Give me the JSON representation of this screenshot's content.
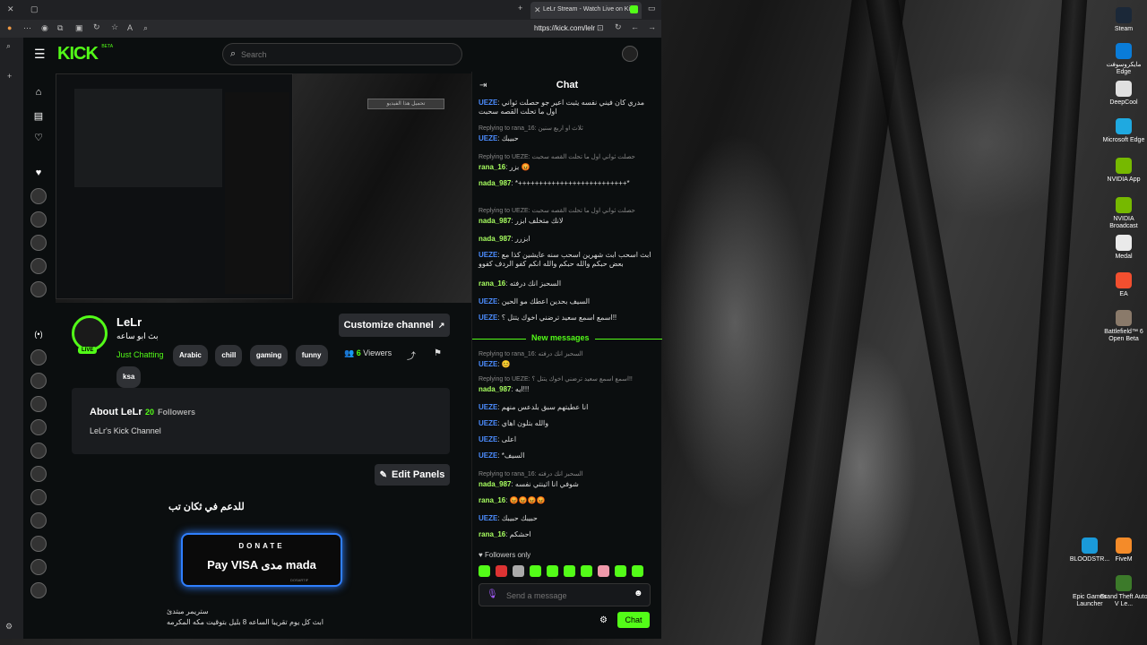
{
  "browser": {
    "tab_title": "LeLr Stream - Watch Live on Kick",
    "url": "https://kick.com/lelr"
  },
  "kick": {
    "logo_text": "KICK",
    "logo_beta": "BETA",
    "search_placeholder": "Search",
    "player_overlay_text": "تحميل هذا الفيديو",
    "channel": {
      "name": "LeLr",
      "stream_title": "بث ابو ساعه",
      "live_badge": "LIVE",
      "category": "Just Chatting",
      "tags": [
        "Arabic",
        "chill",
        "gaming",
        "funny",
        "ksa"
      ],
      "viewers_count": "6",
      "viewers_label": "Viewers",
      "customize_label": "Customize channel",
      "about_label": "About LeLr",
      "followers_count": "20",
      "followers_label": "Followers",
      "about_text": "LeLr's Kick Channel",
      "edit_panels_label": "Edit Panels",
      "panel_title": "للدعم في ثكان تب",
      "donate_label": "DONATE",
      "donate_payment": "Pay VISA مدى mada",
      "donate_footer": "DOSARTIF",
      "streamer_label": "ستريمر مبتدئ",
      "schedule_text": "ابث كل يوم تقريبا الساعه 8 بليل بتوقيت مكه المكرمه"
    },
    "chat": {
      "title": "Chat",
      "new_messages_label": "New messages",
      "followers_only_label": "Followers only",
      "input_placeholder": "Send a message",
      "send_label": "Chat",
      "messages": [
        {
          "user": "UEZE",
          "text": "مدري كان فيني نفسه يثبت اعير جو حصلت ثواني اول ما تحلت القصه سحبت",
          "reply": ""
        },
        {
          "user": "UEZE",
          "text": "حبيبك",
          "reply": "Replying to rana_16: ثلاث او اربع سنين"
        },
        {
          "user": "rana_16",
          "text": "بزر 😡",
          "reply": "Replying to UEZE: حصلت ثواني اول ما تحلت القصه سحبت"
        },
        {
          "user": "nada_987",
          "text": "*++++++++++++++++++++++++++*",
          "reply": ""
        },
        {
          "user": "nada_987",
          "text": "لانك متخلف ابزر",
          "reply": "Replying to UEZE: حصلت ثواني اول ما تحلت القصه سحبت"
        },
        {
          "user": "nada_987",
          "text": "ابزرر",
          "reply": ""
        },
        {
          "user": "UEZE",
          "text": "ابث اسحب ابث شهرين اسحب سنه عايشين كذا مع بعض حبكم والله حبكم والله انكم كفو الردف كفوو",
          "reply": ""
        },
        {
          "user": "rana_16",
          "text": "السحبز انك درفته",
          "reply": ""
        },
        {
          "user": "UEZE",
          "text": "السيف بحدين اعطك مو الحين",
          "reply": ""
        },
        {
          "user": "UEZE",
          "text": "اسمع اسمع سعيد ترضني اخوك يتتل ؟!!",
          "reply": ""
        }
      ],
      "new_messages": [
        {
          "user": "UEZE",
          "text": "😊",
          "reply": "Replying to rana_16: السحبز انك درفته"
        },
        {
          "user": "nada_987",
          "text": "ايه!!!",
          "reply": "Replying to UEZE: اسمع اسمع سعيد ترضني اخوك يتتل ؟!!"
        },
        {
          "user": "UEZE",
          "text": "انا عطيتهم سبق بلدعس منهم",
          "reply": ""
        },
        {
          "user": "UEZE",
          "text": "والله بتلون اهاي",
          "reply": ""
        },
        {
          "user": "UEZE",
          "text": "اعلى",
          "reply": ""
        },
        {
          "user": "UEZE",
          "text": "*السيف",
          "reply": ""
        },
        {
          "user": "nada_987",
          "text": "شوفي انا اثينتي نفسه",
          "reply": "Replying to rana_16: السحبز انك درفته"
        },
        {
          "user": "rana_16",
          "text": "😡😡😡😡",
          "reply": ""
        },
        {
          "user": "UEZE",
          "text": "حبيبك حبيبك",
          "reply": ""
        },
        {
          "user": "rana_16",
          "text": "احشكم",
          "reply": ""
        }
      ]
    }
  },
  "desktop_icons": [
    {
      "label": "Steam",
      "color": "#1b2838"
    },
    {
      "label": "مايكروسوفت Edge",
      "color": "#0a7cd8"
    },
    {
      "label": "DeepCool",
      "color": "#e0e0e0"
    },
    {
      "label": "Microsoft Edge",
      "color": "#1fa9e0"
    },
    {
      "label": "NVIDIA App",
      "color": "#76b900"
    },
    {
      "label": "NVIDIA Broadcast",
      "color": "#76b900"
    },
    {
      "label": "Medal",
      "color": "#eaeaea"
    },
    {
      "label": "EA",
      "color": "#f24f2f"
    },
    {
      "label": "Battlefield™ 6 Open Beta",
      "color": "#8a7a6a"
    },
    {
      "label": "BLOODSTR...",
      "color": "#1a9ad9"
    },
    {
      "label": "FiveM",
      "color": "#f48b29"
    },
    {
      "label": "Epic Games Launcher",
      "color": "#222"
    },
    {
      "label": "Grand Theft Auto V Le...",
      "color": "#3c7a2a"
    }
  ],
  "colors": {
    "kick_green": "#53fc18",
    "username_blue": "#4c8dff",
    "username_green": "#a8ff60"
  }
}
